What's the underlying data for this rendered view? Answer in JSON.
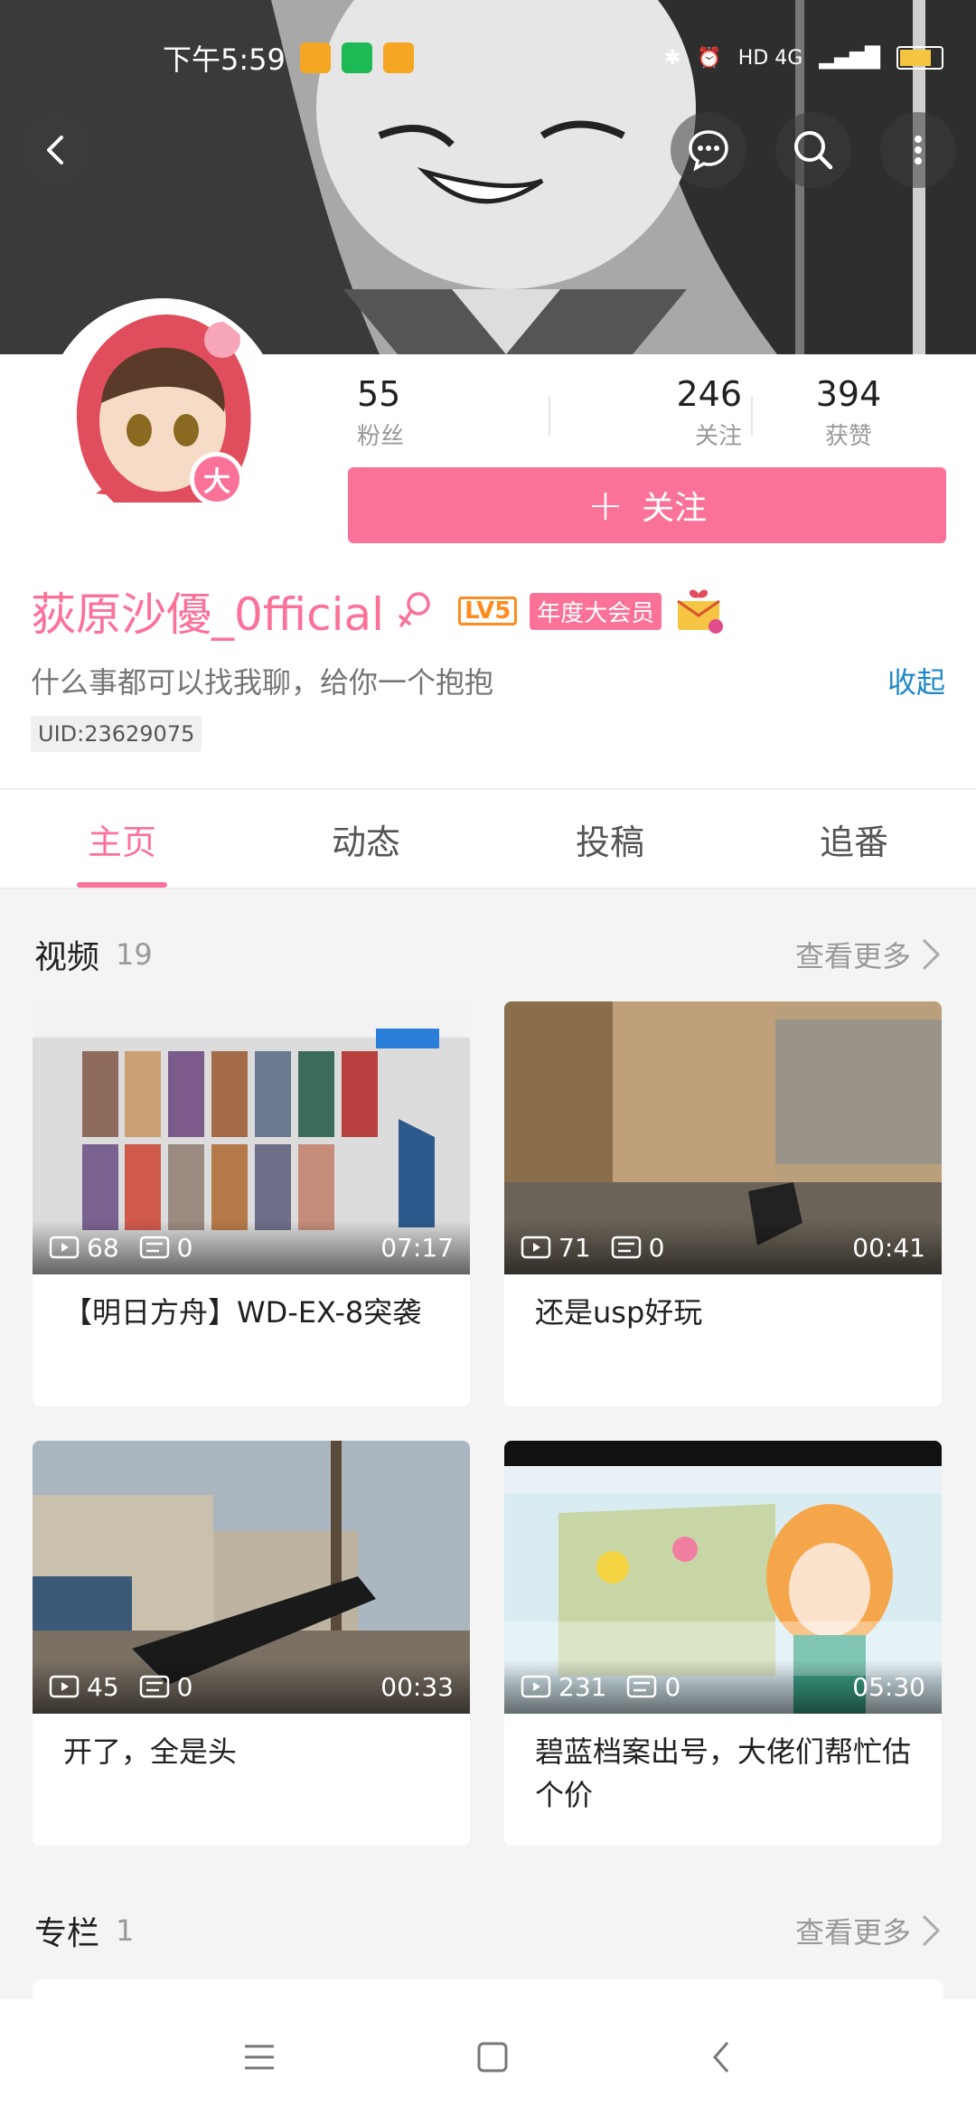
{
  "status_bar": {
    "time": "下午5:59",
    "network": "HD 4G",
    "battery": "77"
  },
  "header": {
    "back_icon": "back-arrow-icon",
    "message_icon": "chat-bubble-icon",
    "search_icon": "search-icon",
    "more_icon": "more-vertical-icon"
  },
  "profile": {
    "stats": [
      {
        "value": "55",
        "label": "粉丝"
      },
      {
        "value": "246",
        "label": "关注"
      },
      {
        "value": "394",
        "label": "获赞"
      }
    ],
    "follow_label": "关注",
    "name": "荻原沙優_0fficial",
    "level": "LV5",
    "vip_label": "年度大会员",
    "signature": "什么事都可以找我聊，给你一个抱抱",
    "collapse_label": "收起",
    "uid": "UID:23629075",
    "avatar_badge": "大"
  },
  "tabs": [
    {
      "label": "主页",
      "active": true
    },
    {
      "label": "动态",
      "active": false
    },
    {
      "label": "投稿",
      "active": false
    },
    {
      "label": "追番",
      "active": false
    }
  ],
  "videos_section": {
    "title": "视频",
    "count": "19",
    "more_label": "查看更多"
  },
  "videos": [
    {
      "plays": "68",
      "comments": "0",
      "duration": "07:17",
      "title": "【明日方舟】WD-EX-8突袭"
    },
    {
      "plays": "71",
      "comments": "0",
      "duration": "00:41",
      "title": "还是usp好玩"
    },
    {
      "plays": "45",
      "comments": "0",
      "duration": "00:33",
      "title": "开了，全是头"
    },
    {
      "plays": "231",
      "comments": "0",
      "duration": "05:30",
      "title": "碧蓝档案出号，大佬们帮忙估个价"
    }
  ],
  "column_section": {
    "title": "专栏",
    "count": "1",
    "more_label": "查看更多"
  },
  "colors": {
    "accent": "#fb7299",
    "link": "#1e88c9"
  }
}
